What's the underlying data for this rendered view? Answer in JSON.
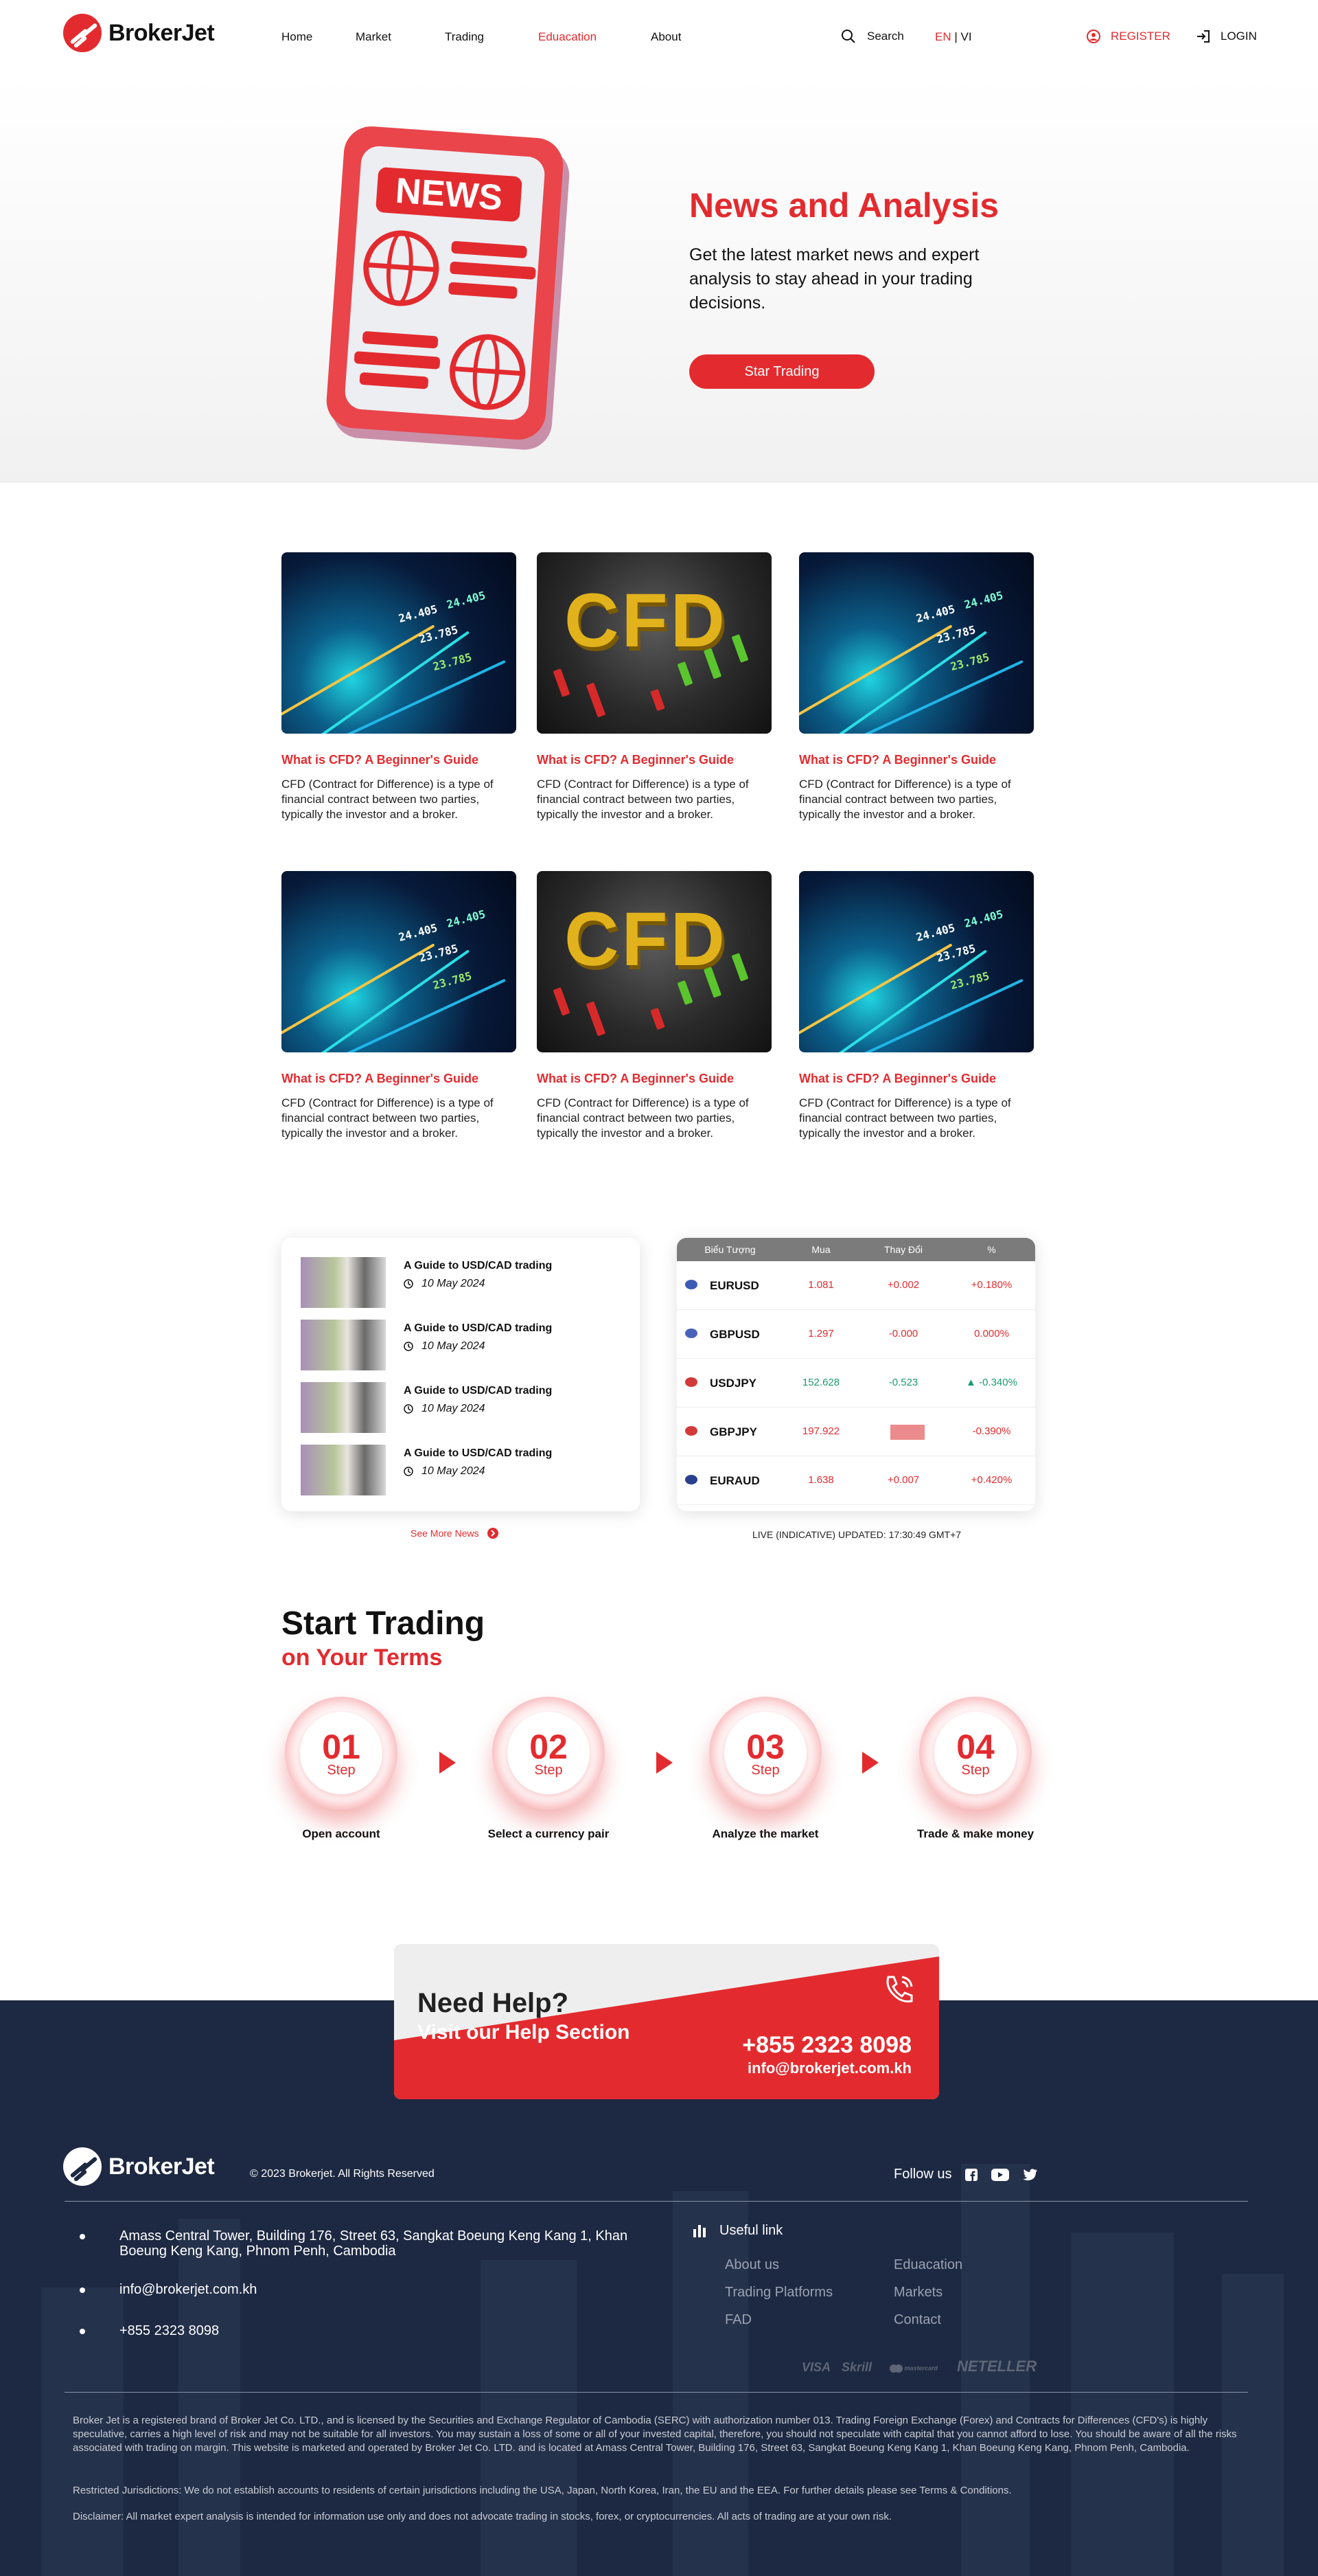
{
  "header": {
    "logo_text": "BrokerJet",
    "nav": [
      {
        "label": "Home",
        "active": false
      },
      {
        "label": "Market",
        "active": false
      },
      {
        "label": "Trading",
        "active": false
      },
      {
        "label": "Eduacation",
        "active": true
      },
      {
        "label": "About",
        "active": false
      }
    ],
    "search_label": "Search",
    "lang_en": "EN",
    "lang_sep": " | ",
    "lang_vi": "VI",
    "register_label": "REGISTER",
    "login_label": "LOGIN"
  },
  "hero": {
    "tag": "NEWS",
    "title": "News and Analysis",
    "subtitle": "Get the latest market news and expert analysis to stay ahead in your trading decisions.",
    "button": "Star Trading"
  },
  "articles": [
    {
      "image": "chart",
      "title": "What is CFD? A Beginner's Guide",
      "text": "CFD (Contract for Difference) is a type of financial contract between two parties, typically the investor and a broker."
    },
    {
      "image": "cfd",
      "title": "What is CFD? A Beginner's Guide",
      "text": "CFD (Contract for Difference) is a type of financial contract between two parties, typically the investor and a broker."
    },
    {
      "image": "chart",
      "title": "What is CFD? A Beginner's Guide",
      "text": "CFD (Contract for Difference) is a type of financial contract between two parties, typically the investor and a broker."
    },
    {
      "image": "chart",
      "title": "What is CFD? A Beginner's Guide",
      "text": "CFD (Contract for Difference) is a type of financial contract between two parties, typically the investor and a broker."
    },
    {
      "image": "cfd",
      "title": "What is CFD? A Beginner's Guide",
      "text": "CFD (Contract for Difference) is a type of financial contract between two parties, typically the investor and a broker."
    },
    {
      "image": "chart",
      "title": "What is CFD? A Beginner's Guide",
      "text": "CFD (Contract for Difference) is a type of financial contract between two parties, typically the investor and a broker."
    }
  ],
  "chart_image_numbers": [
    "24.405",
    "23.785",
    "24.405",
    "23.785"
  ],
  "cfd_word": "CFD",
  "news_list": {
    "items": [
      {
        "title": "A Guide to USD/CAD trading",
        "date": "10 May 2024"
      },
      {
        "title": "A Guide to USD/CAD trading",
        "date": "10 May 2024"
      },
      {
        "title": "A Guide to USD/CAD trading",
        "date": "10 May 2024"
      },
      {
        "title": "A Guide to USD/CAD trading",
        "date": "10 May 2024"
      }
    ],
    "see_more": "See More News"
  },
  "rates": {
    "headers": [
      "Biểu Tượng",
      "Mua",
      "Thay Đổi",
      "%"
    ],
    "rows": [
      {
        "symbol": "EURUSD",
        "buy": "1.081",
        "change": "+0.002",
        "pct": "+0.180%",
        "flag": "#3b5bb5",
        "buy_color": "#e32b2f",
        "change_color": "#e32b2f",
        "pct_color": "#e32b2f",
        "arrow": ""
      },
      {
        "symbol": "GBPUSD",
        "buy": "1.297",
        "change": "-0.000",
        "pct": "0.000%",
        "flag": "#4863b9",
        "buy_color": "#e32b2f",
        "change_color": "#e32b2f",
        "pct_color": "#e32b2f",
        "arrow": ""
      },
      {
        "symbol": "USDJPY",
        "buy": "152.628",
        "change": "-0.523",
        "pct": "-0.340%",
        "flag": "#d23a3a",
        "buy_color": "#1b9b6f",
        "change_color": "#1b9b6f",
        "pct_color": "#1b9b6f",
        "arrow": "▲"
      },
      {
        "symbol": "GBPJPY",
        "buy": "197.922",
        "change": "",
        "pct": "-0.390%",
        "flag": "#d23a3a",
        "buy_color": "#e32b2f",
        "change_color": "#e32b2f",
        "pct_color": "#e32b2f",
        "arrow": "",
        "highlight": "#ec8b8d"
      },
      {
        "symbol": "EURAUD",
        "buy": "1.638",
        "change": "+0.007",
        "pct": "+0.420%",
        "flag": "#2b3f8f",
        "buy_color": "#e32b2f",
        "change_color": "#e32b2f",
        "pct_color": "#e32b2f",
        "arrow": ""
      }
    ],
    "updated": "LIVE (INDICATIVE) UPDATED: 17:30:49 GMT+7"
  },
  "steps": {
    "title": "Start Trading",
    "subtitle": "on Your Terms",
    "word": "Step",
    "items": [
      {
        "num": "01",
        "label": "Open account"
      },
      {
        "num": "02",
        "label": "Select a currency pair"
      },
      {
        "num": "03",
        "label": "Analyze the market"
      },
      {
        "num": "04",
        "label": "Trade & make money"
      }
    ]
  },
  "help": {
    "title": "Need Help?",
    "subtitle": "Visit our Help Section",
    "phone": "+855 2323 8098",
    "email": "info@brokerjet.com.kh"
  },
  "footer": {
    "logo_text": "BrokerJet",
    "copyright": "© 2023 Brokerjet. All Rights Reserved",
    "follow": "Follow us",
    "address": "Amass Central Tower, Building 176, Street 63, Sangkat Boeung Keng Kang 1, Khan Boeung Keng Kang, Phnom Penh, Cambodia",
    "email": "info@brokerjet.com.kh",
    "phone": "+855 2323 8098",
    "useful_title": "Useful link",
    "links": [
      "About us",
      "Eduacation",
      "Trading Platforms",
      "Markets",
      "FAD",
      "Contact"
    ],
    "payments": [
      "VISA",
      "Skrill",
      "mastercard",
      "NETELLER"
    ],
    "legal_1": "Broker Jet is a registered brand of Broker Jet Co. LTD., and is licensed by the Securities and Exchange Regulator of Cambodia (SERC) with authorization number 013. Trading Foreign Exchange (Forex) and Contracts for Differences (CFD's) is highly speculative, carries a high level of risk and may not be suitable for all investors. You may sustain a loss of some or all of your invested capital, therefore, you should not speculate with capital that you cannot afford to lose. You should be aware of all the risks associated with trading on margin. This website is marketed and operated by Broker Jet Co. LTD. and is located at Amass Central Tower, Building 176, Street 63, Sangkat Boeung Keng Kang 1, Khan Boeung Keng Kang, Phnom Penh, Cambodia.",
    "legal_2": "Restricted Jurisdictions: We do not establish accounts to residents of certain jurisdictions including the USA, Japan, North Korea, Iran, the EU and the EEA. For further details please see Terms & Conditions.",
    "legal_3": "Disclaimer: All market expert analysis is intended for information use only and does not advocate trading in stocks, forex, or cryptocurrencies. All acts of trading are at your own risk."
  },
  "colors": {
    "accent": "#e32b2f",
    "footer_bg": "#1d2942",
    "table_head": "#7b7b7b"
  }
}
